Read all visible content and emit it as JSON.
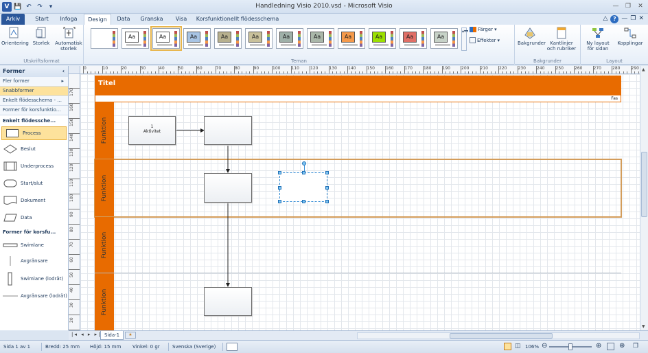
{
  "window": {
    "title": "Handledning Visio 2010.vsd - Microsoft Visio",
    "app_icon": "V"
  },
  "ribbon": {
    "tabs": [
      "Arkiv",
      "Start",
      "Infoga",
      "Design",
      "Data",
      "Granska",
      "Visa",
      "Korsfunktionellt flödesschema"
    ],
    "active_tab": "Design",
    "page_setup": {
      "orientation": "Orientering",
      "size": "Storlek",
      "auto_size_line1": "Automatisk",
      "auto_size_line2": "storlek",
      "group_label": "Utskriftsformat"
    },
    "themes": {
      "group_label": "Teman",
      "sample_text": "Aa",
      "colors_label": "Färger",
      "effects_label": "Effekter"
    },
    "backgrounds": {
      "backgrounds_label": "Bakgrunder",
      "borders_line1": "Kantlinjer",
      "borders_line2": "och rubriker",
      "group_label": "Bakgrunder"
    },
    "layout": {
      "relayout_line1": "Ny layout",
      "relayout_line2": "för sidan",
      "connectors_label": "Kopplingar",
      "group_label": "Layout"
    },
    "theme_colors": [
      "#ffffff",
      "#ffffff",
      "#ffffff",
      "#a8c4e4",
      "#b7b08e",
      "#c9c19b",
      "#9fb0a8",
      "#aab7a9",
      "#f59a4b",
      "#9be000",
      "#e06e65",
      "#c7d2c7"
    ]
  },
  "shapes_panel": {
    "header": "Former",
    "stencils": [
      "Fler former",
      "Snabbformer",
      "Enkelt flödesschema - ...",
      "Former för korsfunktio..."
    ],
    "section1_title": "Enkelt flödessche...",
    "masters1": [
      "Process",
      "Beslut",
      "Underprocess",
      "Start/slut",
      "Dokument",
      "Data"
    ],
    "section2_title": "Former för korsfu...",
    "masters2": [
      {
        "label": "Swimlane"
      },
      {
        "label": "Avgränsare"
      },
      {
        "label": "Swimlane (lodrät)"
      },
      {
        "label": "Avgränsare (lodrät)"
      }
    ]
  },
  "ruler": {
    "h_labels": [
      "0",
      "10",
      "20",
      "30",
      "40",
      "50",
      "60",
      "70",
      "80",
      "90",
      "100",
      "110",
      "120",
      "130",
      "140",
      "150",
      "160",
      "170",
      "180",
      "190",
      "200",
      "210",
      "220",
      "230",
      "240",
      "250",
      "260",
      "270",
      "280",
      "290"
    ],
    "v_labels": [
      "170",
      "160",
      "150",
      "140",
      "130",
      "120",
      "110",
      "100",
      "90",
      "80",
      "70",
      "60",
      "50",
      "40",
      "30",
      "20",
      "10"
    ]
  },
  "diagram": {
    "title": "Titel",
    "phase_label": "Fas",
    "lane_label": "Funktion",
    "activity_number": "1",
    "activity_label": "Aktivitet",
    "lane_color": "#e86b00"
  },
  "page_tabs": {
    "page_name": "Sida-1"
  },
  "status_bar": {
    "page": "Sida 1 av 1",
    "width": "Bredd: 25 mm",
    "height": "Höjd: 15 mm",
    "angle": "Vinkel: 0 gr",
    "language": "Svenska (Sverige)",
    "zoom": "106%"
  }
}
